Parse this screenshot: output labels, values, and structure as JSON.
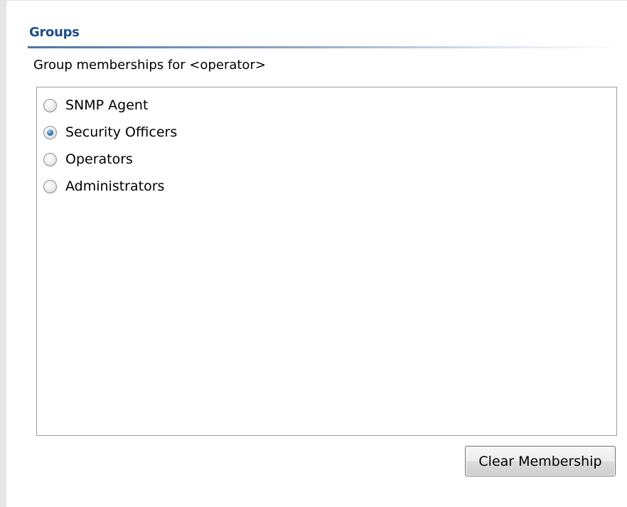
{
  "section": {
    "title": "Groups",
    "subtitle": "Group memberships for <operator>"
  },
  "groups": [
    {
      "label": "SNMP Agent",
      "selected": false
    },
    {
      "label": "Security Officers",
      "selected": true
    },
    {
      "label": "Operators",
      "selected": false
    },
    {
      "label": "Administrators",
      "selected": false
    }
  ],
  "actions": {
    "clear_label": "Clear Membership"
  },
  "colors": {
    "title": "#1e4e87",
    "radio_selected": "#3c86c6",
    "list_border": "#9b9b9b"
  }
}
